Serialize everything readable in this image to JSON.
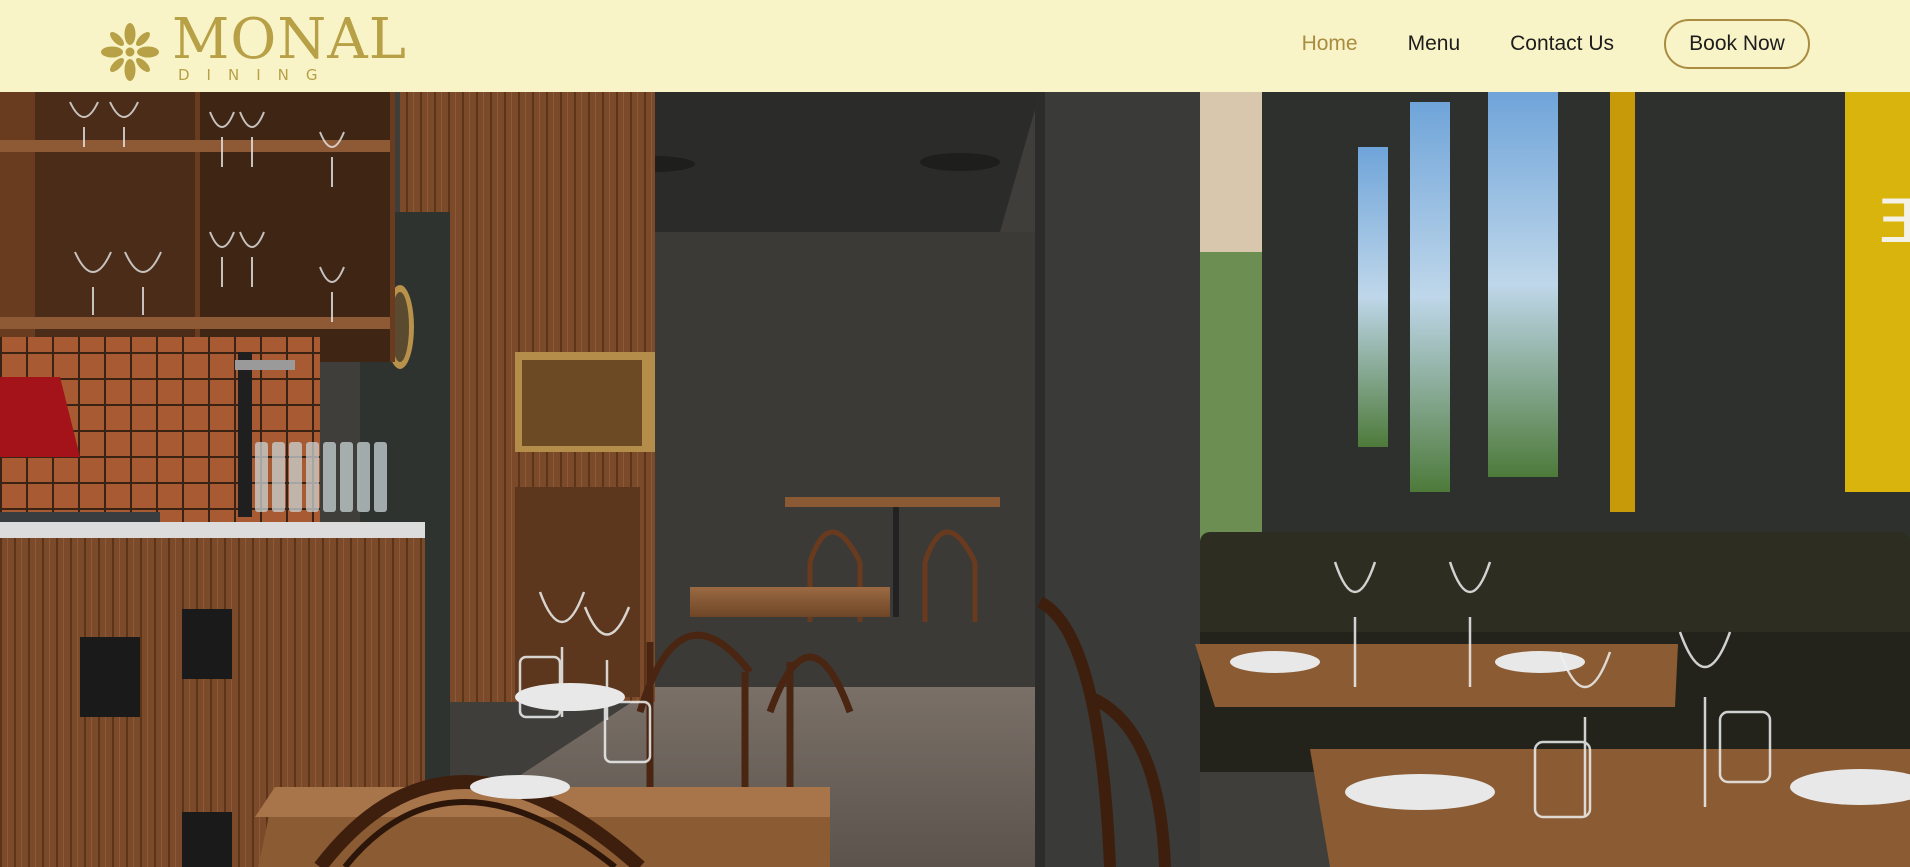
{
  "brand": {
    "name": "MONAL",
    "tagline": "DINING",
    "color": "#b8a047"
  },
  "nav": {
    "items": [
      {
        "label": "Home",
        "active": true
      },
      {
        "label": "Menu",
        "active": false
      },
      {
        "label": "Contact Us",
        "active": false
      }
    ],
    "cta_label": "Book Now",
    "active_color": "#a98c3f"
  },
  "hero": {
    "image_alt_icon": "restaurant-interior-photo"
  },
  "colors": {
    "header_bg": "#f8f4c7",
    "accent": "#a98c3f"
  }
}
